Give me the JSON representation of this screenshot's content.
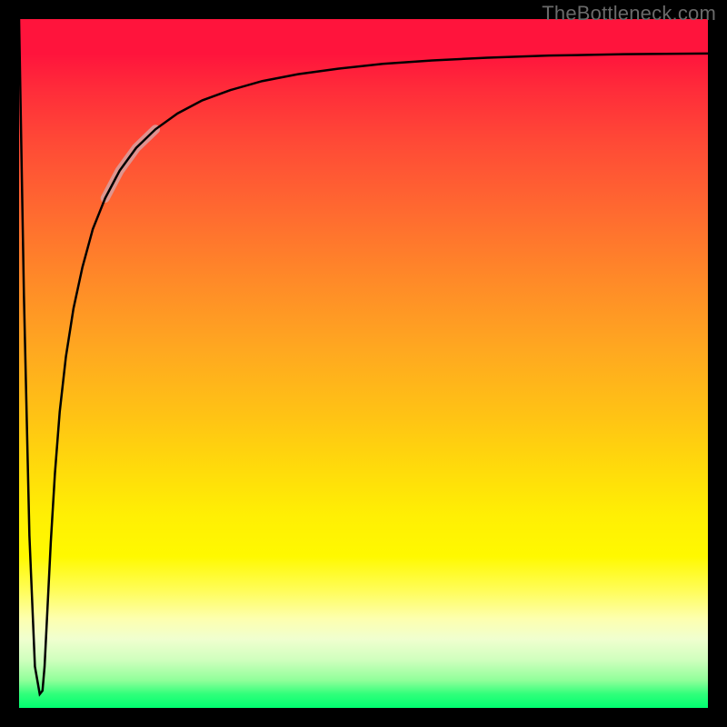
{
  "watermark": "TheBottleneck.com",
  "chart_data": {
    "type": "line",
    "title": "",
    "xlabel": "",
    "ylabel": "",
    "xlim": [
      0,
      100
    ],
    "ylim": [
      0,
      100
    ],
    "grid": false,
    "axes_visible": false,
    "legend": false,
    "background_gradient": {
      "orientation": "vertical",
      "stops": [
        {
          "pos": 0.0,
          "color": "#ff143c"
        },
        {
          "pos": 0.5,
          "color": "#ffa820"
        },
        {
          "pos": 0.78,
          "color": "#fff900"
        },
        {
          "pos": 1.0,
          "color": "#00ff70"
        }
      ]
    },
    "series": [
      {
        "name": "bottleneck-curve",
        "color": "#000000",
        "stroke_width": 2.5,
        "x": [
          0.0,
          0.7,
          1.5,
          2.3,
          3.0,
          3.4,
          3.7,
          4.1,
          4.6,
          5.2,
          5.9,
          6.8,
          7.9,
          9.2,
          10.7,
          12.5,
          14.6,
          17.0,
          19.8,
          23.0,
          26.6,
          30.7,
          35.3,
          40.5,
          46.3,
          52.8,
          60.0,
          68.0,
          76.9,
          87.8,
          100.0
        ],
        "y": [
          100.0,
          60.0,
          25.0,
          6.0,
          2.0,
          2.5,
          6.0,
          14.0,
          24.0,
          34.0,
          43.0,
          51.0,
          58.0,
          64.0,
          69.5,
          74.0,
          78.0,
          81.3,
          84.0,
          86.3,
          88.2,
          89.7,
          91.0,
          92.0,
          92.8,
          93.5,
          94.0,
          94.4,
          94.7,
          94.9,
          95.0
        ]
      },
      {
        "name": "highlight-segment",
        "color": "#d8a0a0",
        "stroke_width": 10,
        "opacity": 0.85,
        "x": [
          12.5,
          14.6,
          17.0,
          19.8
        ],
        "y": [
          74.0,
          78.0,
          81.3,
          84.0
        ]
      }
    ]
  }
}
